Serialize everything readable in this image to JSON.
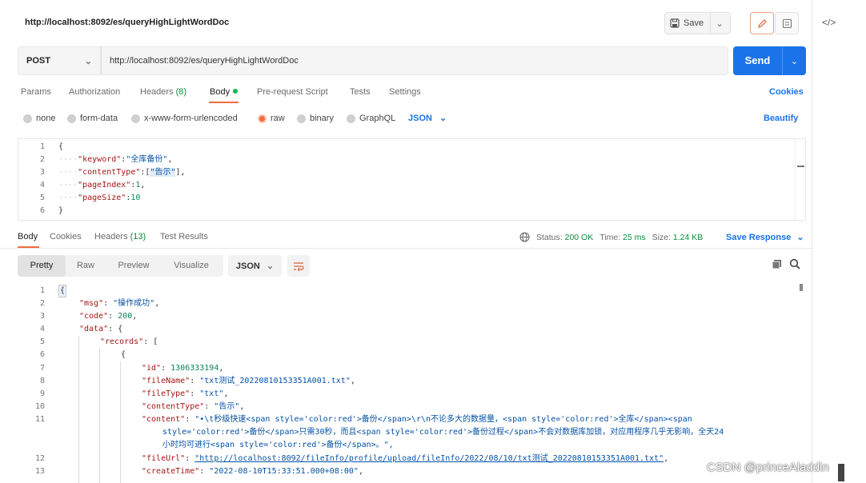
{
  "request": {
    "title": "http://localhost:8092/es/queryHighLightWordDoc",
    "method": "POST",
    "url": "http://localhost:8092/es/queryHighLightWordDoc",
    "save_label": "Save",
    "send_label": "Send"
  },
  "request_tabs": {
    "params": "Params",
    "authorization": "Authorization",
    "headers": "Headers",
    "headers_count": "(8)",
    "body": "Body",
    "pre_request": "Pre-request Script",
    "tests": "Tests",
    "settings": "Settings",
    "cookies": "Cookies"
  },
  "body_types": {
    "none": "none",
    "form_data": "form-data",
    "urlencoded": "x-www-form-urlencoded",
    "raw": "raw",
    "binary": "binary",
    "graphql": "GraphQL",
    "format": "JSON",
    "beautify": "Beautify",
    "selected": "raw"
  },
  "request_body": {
    "line_numbers": [
      "1",
      "2",
      "3",
      "4",
      "5",
      "6"
    ],
    "l1": "{",
    "k_keyword": "\"keyword\"",
    "v_keyword": "\"全库备份\"",
    "k_contentType": "\"contentType\"",
    "v_contentType_pre": "[",
    "v_contentType": "\"告示\"",
    "v_contentType_post": "],",
    "k_pageIndex": "\"pageIndex\"",
    "v_pageIndex": "1",
    "k_pageSize": "\"pageSize\"",
    "v_pageSize": "10",
    "l6": "}"
  },
  "response_tabs": {
    "body": "Body",
    "cookies": "Cookies",
    "headers": "Headers",
    "headers_count": "(13)",
    "test_results": "Test Results",
    "status_label": "Status:",
    "status_value": "200 OK",
    "time_label": "Time:",
    "time_value": "25 ms",
    "size_label": "Size:",
    "size_value": "1.24 KB",
    "save_response": "Save Response"
  },
  "response_view": {
    "pretty": "Pretty",
    "raw": "Raw",
    "preview": "Preview",
    "visualize": "Visualize",
    "format": "JSON"
  },
  "response_body": {
    "line_numbers": [
      "1",
      "2",
      "3",
      "4",
      "5",
      "6",
      "7",
      "8",
      "9",
      "10",
      "11",
      "12",
      "13"
    ],
    "l1": "{",
    "k_msg": "\"msg\"",
    "v_msg": "\"操作成功\"",
    "k_code": "\"code\"",
    "v_code": "200",
    "k_data": "\"data\"",
    "l4_rest": ": {",
    "k_records": "\"records\"",
    "l5_rest": ": [",
    "l6": "{",
    "k_id": "\"id\"",
    "v_id": "1306333194",
    "k_fileName": "\"fileName\"",
    "v_fileName": "\"txt测试_20220810153351A001.txt\"",
    "k_fileType": "\"fileType\"",
    "v_fileType": "\"txt\"",
    "k_contentType": "\"contentType\"",
    "v_contentType": "\"告示\"",
    "k_content": "\"content\"",
    "v_content_1": "\"•\\t秒级快速<span style='color:red'>备份</span>\\r\\n不论多大的数据量，<span style='color:red'>全库</span><span",
    "v_content_2": "style='color:red'>备份</span>只需30秒，而且<span style='color:red'>备份过程</span>不会对数据库加锁，对应用程序几乎无影响，全天24",
    "v_content_3": "小时均可进行<span style='color:red'>备份</span>。\",",
    "k_fileUrl": "\"fileUrl\"",
    "v_fileUrl": "\"http://localhost:8092/fileInfo/profile/upload/fileInfo/2022/08/10/txt测试_20220810153351A001.txt\"",
    "k_createTime": "\"createTime\"",
    "v_createTime": "\"2022-08-10T15:33:51.000+08:00\""
  },
  "watermark": "CSDN @princeAladdin"
}
